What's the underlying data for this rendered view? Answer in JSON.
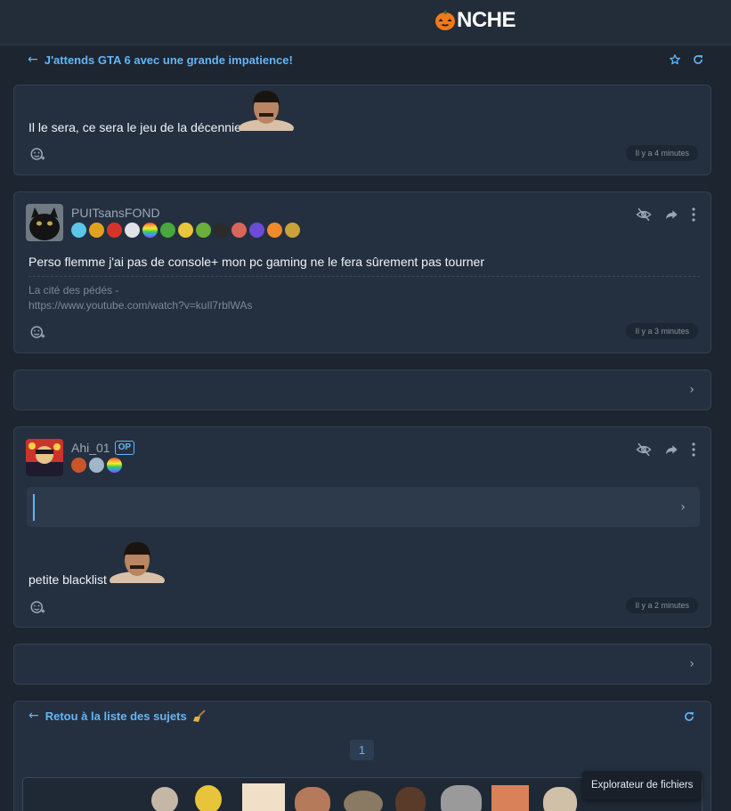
{
  "header": {
    "logo_text": "NCHE"
  },
  "topic": {
    "title": "J'attends GTA 6 avec une grande impatience!"
  },
  "posts": [
    {
      "text": "Il le sera, ce sera le jeu de la décennie",
      "time": "Il y a 4 minutes"
    },
    {
      "username": "PUITsansFOND",
      "text": "Perso flemme j'ai pas de console+ mon pc gaming ne le fera sûrement pas tourner",
      "signature_line1": "La cité des pédés -",
      "signature_line2": "https://www.youtube.com/watch?v=kuIl7rblWAs",
      "time": "Il y a 3 minutes"
    },
    {
      "username": "Ahi_01",
      "op_label": "OP",
      "text": "petite blacklist",
      "time": "Il y a 2 minutes"
    }
  ],
  "footer": {
    "back_label": "Retou à la liste des sujets",
    "page": "1"
  },
  "tooltip": {
    "text": "Explorateur de fichiers"
  },
  "colors": {
    "accent": "#64b5f6",
    "background": "#1c2530",
    "card": "#243040"
  },
  "icons": [
    "pumpkin-icon",
    "arrow-left-icon",
    "star-icon",
    "refresh-icon",
    "emoji-add-icon",
    "eye-off-icon",
    "share-icon",
    "more-vert-icon",
    "chevron-right-icon"
  ]
}
